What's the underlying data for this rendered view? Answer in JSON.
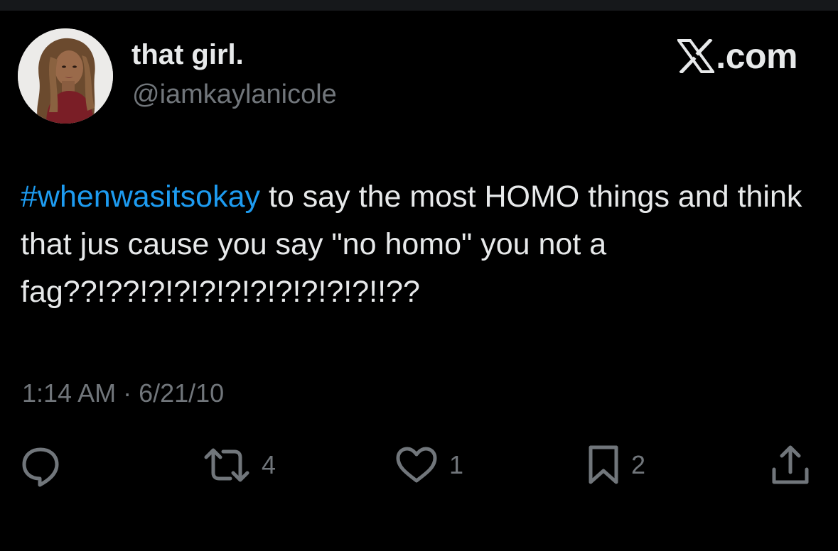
{
  "colors": {
    "background": "#000000",
    "text": "#e7e9ea",
    "secondary": "#71767b",
    "hashtag": "#1d9bf0"
  },
  "author": {
    "display_name": "that girl.",
    "handle": "@iamkaylanicole",
    "avatar": "profile-photo"
  },
  "brand": {
    "text": ".com",
    "icon": "x-logo-icon"
  },
  "tweet": {
    "hashtag": "#whenwasitsokay",
    "text": " to say the most HOMO things and think that jus cause you say \"no homo\" you not a fag??!??!?!?!?!?!?!?!?!?!?!!??"
  },
  "meta": {
    "time": "1:14 AM",
    "separator": " · ",
    "date": "6/21/10"
  },
  "actions": {
    "reply": {
      "icon": "reply-icon",
      "count": ""
    },
    "repost": {
      "icon": "repost-icon",
      "count": "4"
    },
    "like": {
      "icon": "heart-icon",
      "count": "1"
    },
    "bookmark": {
      "icon": "bookmark-icon",
      "count": "2"
    },
    "share": {
      "icon": "share-icon",
      "count": ""
    }
  }
}
